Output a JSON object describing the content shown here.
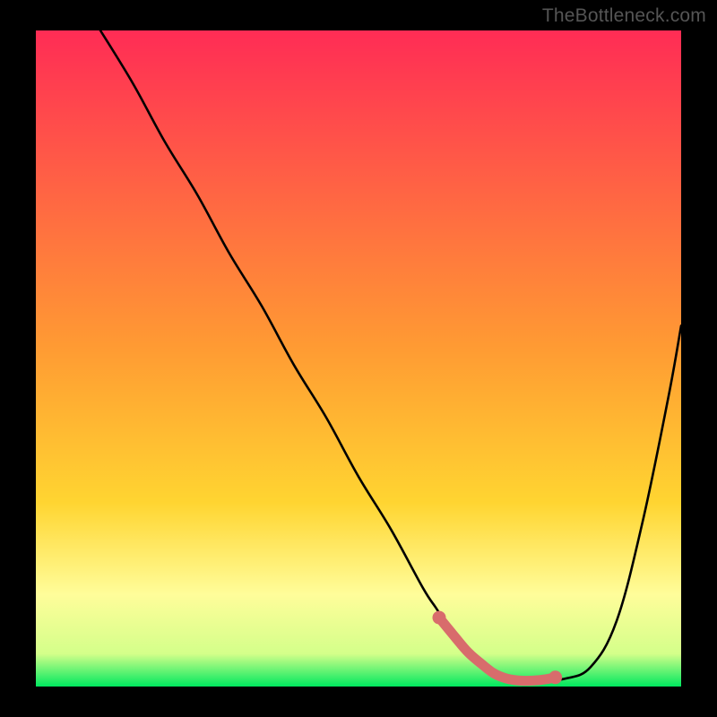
{
  "watermark": "TheBottleneck.com",
  "colors": {
    "gradient_top": "#ff2c55",
    "gradient_mid": "#ffd531",
    "gradient_low": "#fffd9a",
    "gradient_bottom": "#00e85f",
    "line": "#000000",
    "highlight": "#d86c6c",
    "background": "#000000"
  },
  "chart_data": {
    "type": "line",
    "title": "",
    "xlabel": "",
    "ylabel": "",
    "xlim": [
      0,
      100
    ],
    "ylim": [
      0,
      100
    ],
    "series": [
      {
        "name": "bottleneck-curve",
        "x": [
          10,
          15,
          20,
          25,
          30,
          35,
          40,
          45,
          50,
          55,
          60,
          62,
          64,
          66,
          68,
          70,
          72,
          74,
          76,
          78,
          82,
          86,
          90,
          94,
          98,
          100
        ],
        "y": [
          100,
          92,
          83,
          75,
          66,
          58,
          49,
          41,
          32,
          24,
          15,
          12,
          9,
          6,
          4,
          2.5,
          1.5,
          1,
          0.8,
          1,
          1.2,
          3,
          10,
          25,
          44,
          55
        ]
      }
    ],
    "highlight": {
      "name": "optimal-range",
      "x": [
        62.5,
        65,
        67,
        69,
        71,
        73,
        75,
        77,
        79,
        80.5
      ],
      "y": [
        10.5,
        7.5,
        5.2,
        3.5,
        2,
        1.2,
        0.9,
        0.9,
        1.1,
        1.4
      ]
    },
    "highlight_endpoints": [
      {
        "x": 62.5,
        "y": 10.5
      },
      {
        "x": 80.5,
        "y": 1.4
      }
    ]
  }
}
